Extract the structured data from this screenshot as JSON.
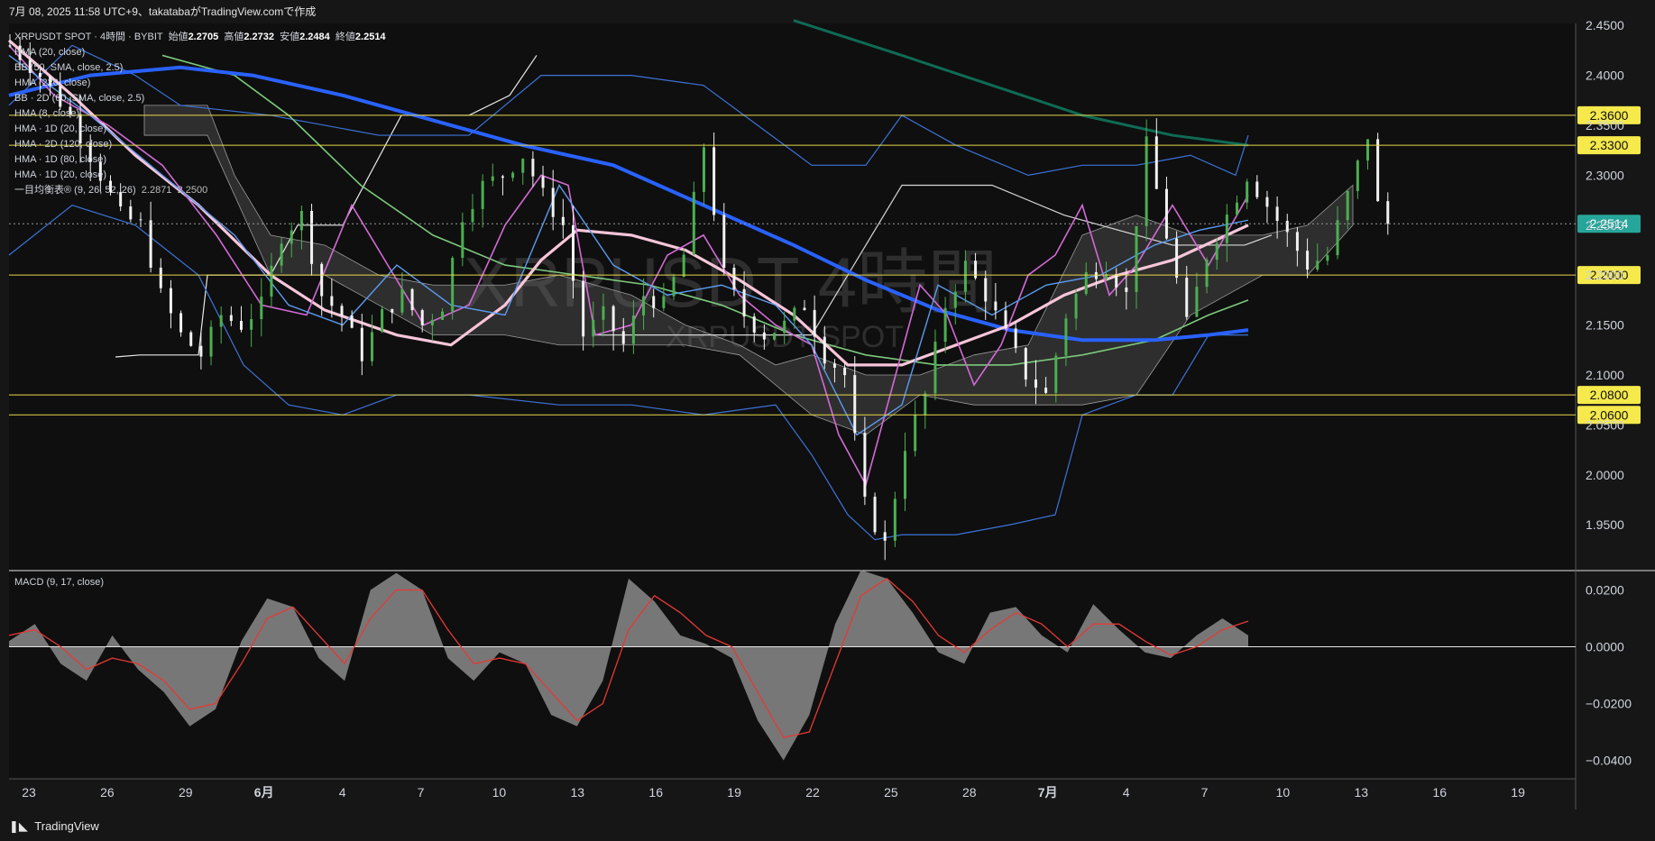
{
  "header": {
    "caption": "7月 08, 2025 11:58 UTC+9、takatabaがTradingView.comで作成"
  },
  "legend": {
    "symbol_line": "XRPUSDT SPOT · 4時間 · BYBIT",
    "open_label": "始値",
    "open": "2.2705",
    "high_label": "高値",
    "high": "2.2732",
    "low_label": "安値",
    "low": "2.2484",
    "close_label": "終値",
    "close": "2.2514",
    "indicators": [
      "HMA (20, close)",
      "BB (50, SMA, close, 2.5)",
      "HMA (220, close)",
      "BB · 2D (60, SMA, close, 2.5)",
      "HMA (8, close)",
      "HMA · 1D (20, close)",
      "HMA · 2D (120, close)",
      "HMA · 1D (80, close)",
      "HMA · 1D (20, close)"
    ],
    "ichimoku": "一目均衡表® (9, 26, 52, 26)",
    "ichimoku_values": [
      "2.2871",
      "2.2500"
    ]
  },
  "watermark": {
    "title": "XRPUSDT 4時間",
    "subtitle": "XRPUSDT SPOT"
  },
  "macd_label": "MACD (9, 17, close)",
  "footer": {
    "brand": "TradingView",
    "logo_glyph": "𝟭𝟳"
  },
  "colors": {
    "background": "#161616",
    "up": "#4caf50",
    "down": "#f2f2f2",
    "hline": "#e8d84a",
    "hma_blue": "#2962ff",
    "hma_pink": "#f7c5d9",
    "hma_magenta": "#d46ad6",
    "hma_green": "#7cc97c",
    "hma_teal": "#0f6b55",
    "bb": "#3d73d8",
    "price_badge": "#26a69a",
    "macd_hist": "#8a8a8a",
    "macd_signal": "#e53935"
  },
  "chart_data": [
    {
      "type": "candlestick",
      "title": "XRPUSDT SPOT · 4時間 · BYBIT",
      "y_axis_ticks": [
        "2.4500",
        "2.4000",
        "2.3500",
        "2.3000",
        "2.2500",
        "2.2000",
        "2.1500",
        "2.1000",
        "2.0500",
        "2.0000",
        "1.9500"
      ],
      "ylim": [
        1.905,
        2.452
      ],
      "x_tick_labels": [
        "23",
        "26",
        "29",
        "6月",
        "4",
        "7",
        "10",
        "13",
        "16",
        "19",
        "22",
        "25",
        "28",
        "7月",
        "4",
        "7",
        "10",
        "13",
        "16",
        "19"
      ],
      "horizontal_lines": [
        {
          "value": 2.36,
          "label": "2.3600"
        },
        {
          "value": 2.33,
          "label": "2.3300"
        },
        {
          "value": 2.2,
          "label": "2.2000"
        },
        {
          "value": 2.08,
          "label": "2.0800"
        },
        {
          "value": 2.06,
          "label": "2.0600"
        }
      ],
      "last_price": {
        "value": 2.2514,
        "label": "2.2514"
      },
      "ohlc_last": {
        "open": 2.2705,
        "high": 2.2732,
        "low": 2.2484,
        "close": 2.2514
      },
      "price_path": [
        [
          0,
          2.43
        ],
        [
          3,
          2.4
        ],
        [
          6,
          2.36
        ],
        [
          9,
          2.3
        ],
        [
          11,
          2.26
        ],
        [
          13,
          2.25
        ],
        [
          15,
          2.18
        ],
        [
          17,
          2.14
        ],
        [
          19,
          2.12
        ],
        [
          21,
          2.16
        ],
        [
          23,
          2.15
        ],
        [
          25,
          2.17
        ],
        [
          27,
          2.24
        ],
        [
          29,
          2.26
        ],
        [
          31,
          2.18
        ],
        [
          33,
          2.16
        ],
        [
          35,
          2.12
        ],
        [
          37,
          2.16
        ],
        [
          39,
          2.18
        ],
        [
          41,
          2.15
        ],
        [
          43,
          2.17
        ],
        [
          45,
          2.26
        ],
        [
          47,
          2.29
        ],
        [
          49,
          2.3
        ],
        [
          51,
          2.32
        ],
        [
          53,
          2.28
        ],
        [
          55,
          2.25
        ],
        [
          57,
          2.14
        ],
        [
          59,
          2.16
        ],
        [
          61,
          2.13
        ],
        [
          63,
          2.18
        ],
        [
          65,
          2.17
        ],
        [
          67,
          2.22
        ],
        [
          69,
          2.33
        ],
        [
          71,
          2.2
        ],
        [
          73,
          2.16
        ],
        [
          75,
          2.14
        ],
        [
          77,
          2.15
        ],
        [
          79,
          2.17
        ],
        [
          81,
          2.12
        ],
        [
          83,
          2.1
        ],
        [
          85,
          1.97
        ],
        [
          87,
          1.93
        ],
        [
          89,
          2.03
        ],
        [
          91,
          2.08
        ],
        [
          93,
          2.17
        ],
        [
          95,
          2.21
        ],
        [
          97,
          2.18
        ],
        [
          99,
          2.14
        ],
        [
          101,
          2.1
        ],
        [
          103,
          2.08
        ],
        [
          105,
          2.16
        ],
        [
          107,
          2.2
        ],
        [
          109,
          2.21
        ],
        [
          111,
          2.18
        ],
        [
          113,
          2.33
        ],
        [
          115,
          2.24
        ],
        [
          117,
          2.15
        ],
        [
          119,
          2.22
        ],
        [
          121,
          2.26
        ],
        [
          123,
          2.3
        ],
        [
          125,
          2.27
        ],
        [
          127,
          2.24
        ],
        [
          129,
          2.21
        ],
        [
          131,
          2.22
        ],
        [
          133,
          2.28
        ],
        [
          135,
          2.34
        ],
        [
          136,
          2.27
        ],
        [
          137,
          2.2514
        ]
      ],
      "series": [
        {
          "name": "HMA (220, close)",
          "values": [
            [
              0,
              2.38
            ],
            [
              20,
              2.405
            ],
            [
              40,
              2.395
            ],
            [
              60,
              2.36
            ],
            [
              80,
              2.32
            ],
            [
              100,
              2.28
            ],
            [
              120,
              2.23
            ],
            [
              135,
              2.19
            ],
            [
              155,
              2.14
            ],
            [
              175,
              2.13
            ],
            [
              195,
              2.14
            ],
            [
              230,
              2.145
            ]
          ]
        },
        {
          "name": "HMA (20, close)",
          "values": [
            [
              0,
              2.43
            ],
            [
              30,
              2.32
            ],
            [
              50,
              2.26
            ],
            [
              70,
              2.195
            ],
            [
              90,
              2.17
            ],
            [
              110,
              2.18
            ],
            [
              130,
              2.25
            ],
            [
              150,
              2.21
            ],
            [
              170,
              2.17
            ],
            [
              190,
              2.12
            ],
            [
              210,
              2.1
            ],
            [
              230,
              2.13
            ],
            [
              250,
              2.2
            ],
            [
              270,
              2.22
            ],
            [
              290,
              2.26
            ]
          ]
        }
      ]
    },
    {
      "type": "histogram",
      "title": "MACD (9, 17, close)",
      "y_axis_ticks": [
        "0.0200",
        "0.0000",
        "−0.0200",
        "−0.0400"
      ],
      "ylim": [
        -0.0465,
        0.0265
      ],
      "macd": [
        [
          0,
          0.002
        ],
        [
          4,
          0.008
        ],
        [
          8,
          -0.006
        ],
        [
          12,
          -0.012
        ],
        [
          16,
          0.004
        ],
        [
          20,
          -0.008
        ],
        [
          24,
          -0.016
        ],
        [
          28,
          -0.028
        ],
        [
          32,
          -0.022
        ],
        [
          36,
          0.002
        ],
        [
          40,
          0.017
        ],
        [
          44,
          0.014
        ],
        [
          48,
          -0.004
        ],
        [
          52,
          -0.012
        ],
        [
          56,
          0.02
        ],
        [
          60,
          0.026
        ],
        [
          64,
          0.02
        ],
        [
          68,
          -0.004
        ],
        [
          72,
          -0.012
        ],
        [
          76,
          -0.002
        ],
        [
          80,
          -0.006
        ],
        [
          84,
          -0.024
        ],
        [
          88,
          -0.028
        ],
        [
          92,
          -0.012
        ],
        [
          96,
          0.024
        ],
        [
          100,
          0.016
        ],
        [
          104,
          0.004
        ],
        [
          108,
          0.001
        ],
        [
          112,
          -0.004
        ],
        [
          116,
          -0.026
        ],
        [
          120,
          -0.04
        ],
        [
          124,
          -0.024
        ],
        [
          128,
          0.008
        ],
        [
          132,
          0.027
        ],
        [
          136,
          0.024
        ],
        [
          140,
          0.012
        ],
        [
          144,
          -0.002
        ],
        [
          148,
          -0.006
        ],
        [
          152,
          0.012
        ],
        [
          156,
          0.014
        ],
        [
          160,
          0.004
        ],
        [
          164,
          -0.002
        ],
        [
          168,
          0.015
        ],
        [
          172,
          0.006
        ],
        [
          176,
          -0.002
        ],
        [
          180,
          -0.004
        ],
        [
          184,
          0.004
        ],
        [
          188,
          0.01
        ],
        [
          192,
          0.004
        ]
      ],
      "signal": [
        [
          0,
          0.004
        ],
        [
          4,
          0.006
        ],
        [
          8,
          0.0
        ],
        [
          12,
          -0.008
        ],
        [
          16,
          -0.004
        ],
        [
          20,
          -0.006
        ],
        [
          24,
          -0.012
        ],
        [
          28,
          -0.022
        ],
        [
          32,
          -0.02
        ],
        [
          36,
          -0.006
        ],
        [
          40,
          0.01
        ],
        [
          44,
          0.014
        ],
        [
          48,
          0.004
        ],
        [
          52,
          -0.006
        ],
        [
          56,
          0.01
        ],
        [
          60,
          0.02
        ],
        [
          64,
          0.02
        ],
        [
          68,
          0.006
        ],
        [
          72,
          -0.006
        ],
        [
          76,
          -0.004
        ],
        [
          80,
          -0.006
        ],
        [
          84,
          -0.016
        ],
        [
          88,
          -0.026
        ],
        [
          92,
          -0.02
        ],
        [
          96,
          0.006
        ],
        [
          100,
          0.018
        ],
        [
          104,
          0.012
        ],
        [
          108,
          0.004
        ],
        [
          112,
          0.0
        ],
        [
          116,
          -0.016
        ],
        [
          120,
          -0.032
        ],
        [
          124,
          -0.03
        ],
        [
          128,
          -0.006
        ],
        [
          132,
          0.018
        ],
        [
          136,
          0.024
        ],
        [
          140,
          0.016
        ],
        [
          144,
          0.004
        ],
        [
          148,
          -0.002
        ],
        [
          152,
          0.006
        ],
        [
          156,
          0.012
        ],
        [
          160,
          0.008
        ],
        [
          164,
          0.0
        ],
        [
          168,
          0.008
        ],
        [
          172,
          0.008
        ],
        [
          176,
          0.002
        ],
        [
          180,
          -0.003
        ],
        [
          184,
          0.0
        ],
        [
          188,
          0.006
        ],
        [
          192,
          0.009
        ]
      ]
    }
  ]
}
